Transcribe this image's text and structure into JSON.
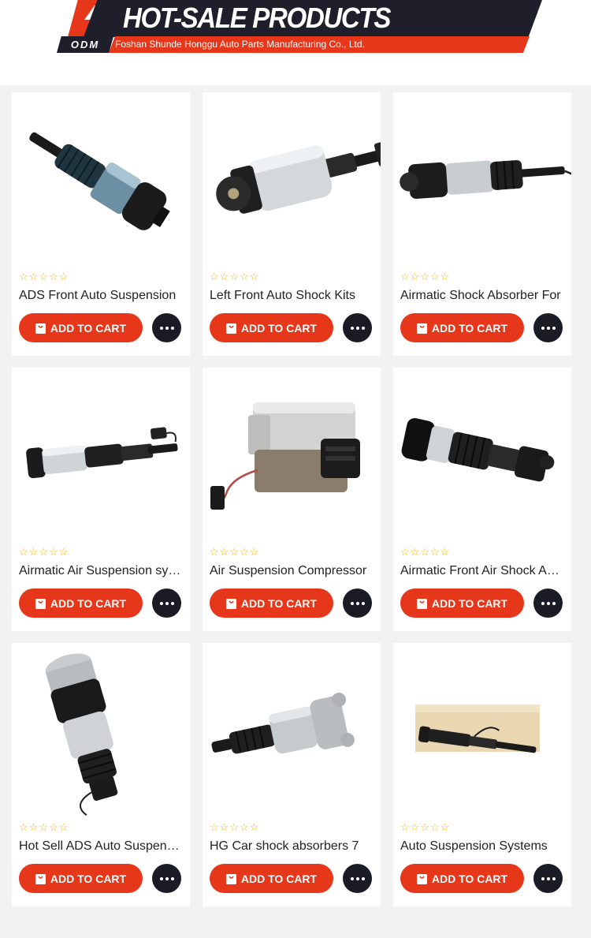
{
  "header": {
    "title": "HOT-SALE PRODUCTS",
    "badge": "ODM",
    "company": "Foshan Shunde Honggu Auto Parts Manufacturing Co., Ltd."
  },
  "colors": {
    "accent": "#e6371b",
    "dark": "#1f1f2b",
    "star": "#f5b400"
  },
  "products": [
    {
      "title": "ADS Front Auto Suspension",
      "rating": 0,
      "cart_label": "ADD TO CART",
      "image": "air-strut-diagonal"
    },
    {
      "title": "Left Front Auto Shock Kits",
      "rating": 0,
      "cart_label": "ADD TO CART",
      "image": "air-spring-horizontal"
    },
    {
      "title": "Airmatic Shock Absorber For",
      "rating": 0,
      "cart_label": "ADD TO CART",
      "image": "airmatic-strut"
    },
    {
      "title": "Airmatic Air Suspension system",
      "rating": 0,
      "cart_label": "ADD TO CART",
      "image": "long-air-strut"
    },
    {
      "title": "Air Suspension Compressor",
      "rating": 0,
      "cart_label": "ADD TO CART",
      "image": "compressor"
    },
    {
      "title": "Airmatic Front Air Shock Absorber",
      "rating": 0,
      "cart_label": "ADD TO CART",
      "image": "front-air-shock"
    },
    {
      "title": "Hot Sell ADS Auto Suspension",
      "rating": 0,
      "cart_label": "ADD TO CART",
      "image": "vertical-air-strut"
    },
    {
      "title": "HG Car shock absorbers 7",
      "rating": 0,
      "cart_label": "ADD TO CART",
      "image": "shock-with-bellows"
    },
    {
      "title": "Auto Suspension Systems",
      "rating": 0,
      "cart_label": "ADD TO CART",
      "image": "boxed-shock"
    }
  ]
}
